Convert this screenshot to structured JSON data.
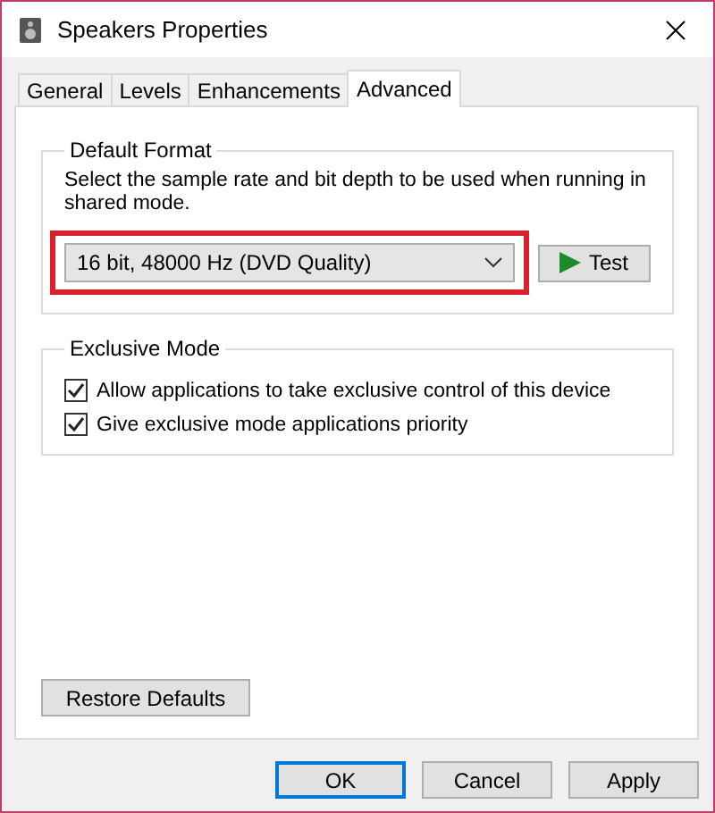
{
  "window": {
    "title": "Speakers Properties"
  },
  "tabs": [
    {
      "label": "General",
      "selected": false
    },
    {
      "label": "Levels",
      "selected": false
    },
    {
      "label": "Enhancements",
      "selected": false
    },
    {
      "label": "Advanced",
      "selected": true
    }
  ],
  "default_format": {
    "title": "Default Format",
    "description": "Select the sample rate and bit depth to be used when running in shared mode.",
    "format": {
      "value": "16 bit, 48000 Hz (DVD Quality)",
      "highlighted": true
    },
    "test_button": "Test"
  },
  "exclusive_mode": {
    "title": "Exclusive Mode",
    "options": [
      {
        "label": "Allow applications to take exclusive control of this device",
        "checked": true
      },
      {
        "label": "Give exclusive mode applications priority",
        "checked": true
      }
    ]
  },
  "restore_button": "Restore Defaults",
  "buttons": [
    {
      "label": "OK",
      "default": true
    },
    {
      "label": "Cancel",
      "default": false
    },
    {
      "label": "Apply",
      "default": false
    }
  ]
}
